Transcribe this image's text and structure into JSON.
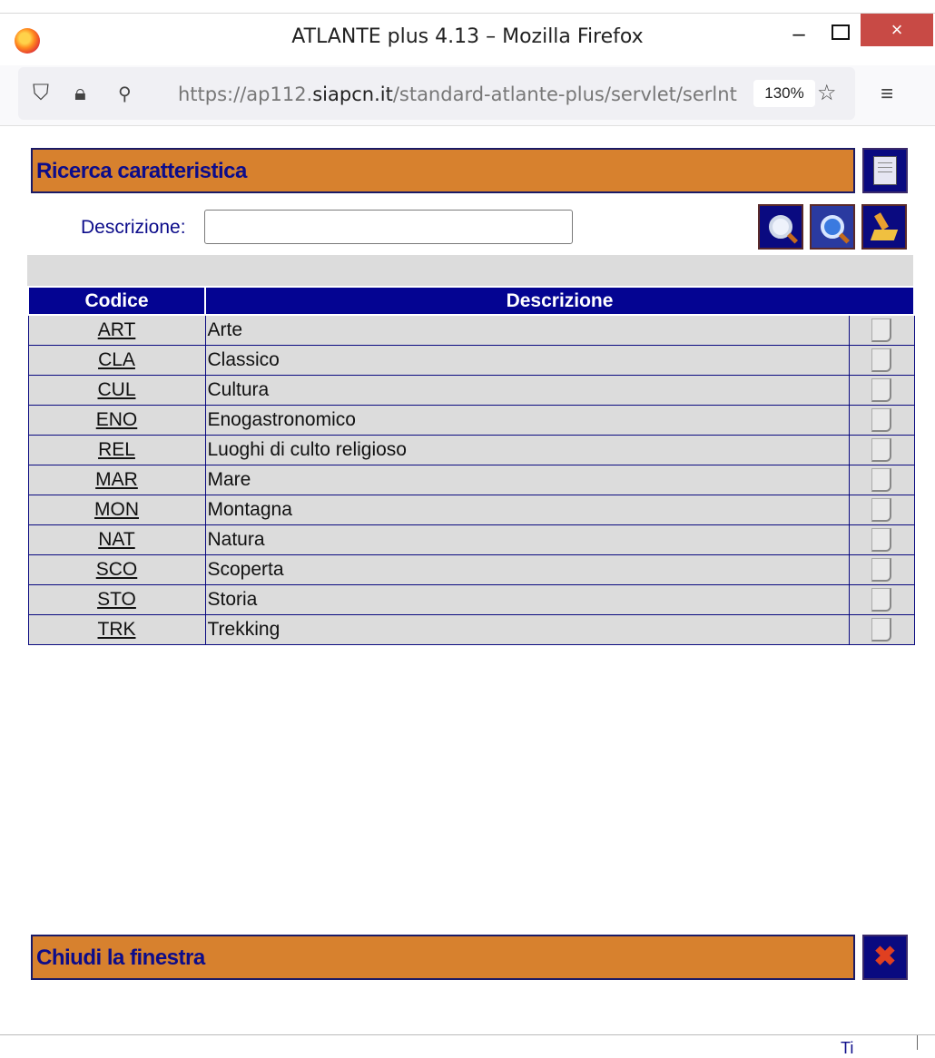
{
  "window": {
    "title": "ATLANTE plus 4.13 – Mozilla Firefox",
    "minimize": "–",
    "close": "×"
  },
  "browser": {
    "url_prefix": "https://ap112.",
    "url_domain": "siapcn.it",
    "url_path": "/standard-atlante-plus/servlet/serlnt",
    "zoom": "130%",
    "menu": "≡",
    "star": "☆"
  },
  "page": {
    "section_title": "Ricerca caratteristica",
    "search_label": "Descrizione:",
    "search_value": "",
    "table": {
      "headers": [
        "Codice",
        "Descrizione"
      ],
      "rows": [
        {
          "code": "ART",
          "description": "Arte"
        },
        {
          "code": "CLA",
          "description": "Classico"
        },
        {
          "code": "CUL",
          "description": "Cultura"
        },
        {
          "code": "ENO",
          "description": "Enogastronomico"
        },
        {
          "code": "REL",
          "description": "Luoghi di culto religioso"
        },
        {
          "code": "MAR",
          "description": "Mare"
        },
        {
          "code": "MON",
          "description": "Montagna"
        },
        {
          "code": "NAT",
          "description": "Natura"
        },
        {
          "code": "SCO",
          "description": "Scoperta"
        },
        {
          "code": "STO",
          "description": "Storia"
        },
        {
          "code": "TRK",
          "description": "Trekking"
        }
      ]
    },
    "close_title": "Chiudi la finestra",
    "footer_text": "Ti"
  },
  "colors": {
    "section_bar": "#d7812e",
    "header_blue": "#040492",
    "text_blue": "#0c0c8a",
    "row_grey": "#dcdcdc"
  }
}
